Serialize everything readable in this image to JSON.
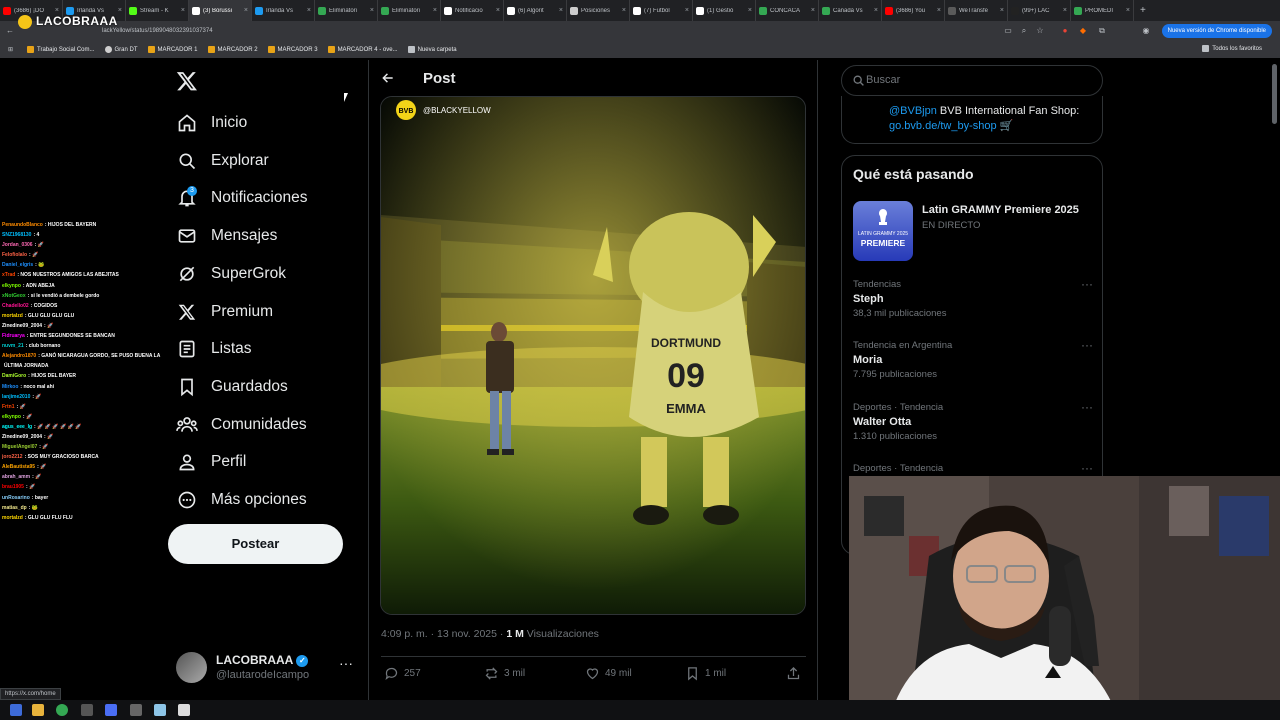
{
  "browser": {
    "tabs": [
      {
        "label": "(3686) ¡DO",
        "color": "#ff0000"
      },
      {
        "label": "Irlanda Vs",
        "color": "#1d9bf0"
      },
      {
        "label": "Stream - K",
        "color": "#53fc18"
      },
      {
        "label": "(3) Borussi",
        "color": "#ffffff",
        "active": true
      },
      {
        "label": "Irlanda Vs",
        "color": "#1d9bf0"
      },
      {
        "label": "Eliminatori",
        "color": "#34a853"
      },
      {
        "label": "Eliminatori",
        "color": "#34a853"
      },
      {
        "label": "Notificacio",
        "color": "#ffffff"
      },
      {
        "label": "(6) Algorit",
        "color": "#ffffff"
      },
      {
        "label": "Posiciones",
        "color": "#cccccc"
      },
      {
        "label": "(7) Futbol",
        "color": "#ffffff"
      },
      {
        "label": "(1) Gestió",
        "color": "#ffffff"
      },
      {
        "label": "CONCACA",
        "color": "#34a853"
      },
      {
        "label": "Canadá Vs",
        "color": "#34a853"
      },
      {
        "label": "(3686) You",
        "color": "#ff0000"
      },
      {
        "label": "WeTransfe",
        "color": "#5a5a5a"
      },
      {
        "label": "(99+) LAC",
        "color": "#222222"
      },
      {
        "label": "PROMEDI",
        "color": "#34a853"
      }
    ],
    "url": "lackYellow/status/1989048032391037374",
    "update_button": "Nueva versión de Chrome disponible",
    "bookmarks": [
      "Trabajo Social Com...",
      "Gran DT",
      "MARCADOR 1",
      "MARCADOR 2",
      "MARCADOR 3",
      "MARCADOR 4 - ove...",
      "Nueva carpeta"
    ],
    "all_bookmarks": "Todos los favoritos",
    "status_url": "https://x.com/home"
  },
  "stream": {
    "logo_text": "LACOBRAAA",
    "chat": [
      {
        "user": "PenaundoBlanco",
        "color": "#ff8c00",
        "msg": "HIJOS DEL BAYERN"
      },
      {
        "user": "SNZ1968130",
        "color": "#00bfff",
        "msg": "4"
      },
      {
        "user": "Jordan_0306",
        "color": "#ff69b4",
        "msg": "🚀"
      },
      {
        "user": "Felofiolalo",
        "color": "#ff6347",
        "msg": "🚀"
      },
      {
        "user": "Daniel_elgris",
        "color": "#1e90ff",
        "msg": "🐸"
      },
      {
        "user": "xTrad",
        "color": "#ff4500",
        "msg": "NOS NUESTROS AMIGOS LAS ABEJITAS"
      },
      {
        "user": "elkynpo",
        "color": "#7fff00",
        "msg": "ADN ABEJA"
      },
      {
        "user": "xNotGeox",
        "color": "#32cd32",
        "msg": "si le vendió a dembele gordo"
      },
      {
        "user": "Chadello02",
        "color": "#ff1493",
        "msg": "COGIDOS"
      },
      {
        "user": "mortalzd",
        "color": "#ffd700",
        "msg": "GLU GLU GLU GLU"
      },
      {
        "user": "Zinedine09_2004",
        "color": "#ffffff",
        "msg": "🚀"
      },
      {
        "user": "Fidruarya",
        "color": "#ff00ff",
        "msg": "ENTRE SEGUNDONES SE BANCAN"
      },
      {
        "user": "nuvm_21",
        "color": "#00ced1",
        "msg": "club bornano"
      },
      {
        "user": "Alejandro1870",
        "color": "#ff8c00",
        "msg": "GANÓ NICARAGUA GORDO, SE PUSO BUENA LA"
      },
      {
        "user": "",
        "color": "#ffffff",
        "msg": "ÚLTIMA JORNADA"
      },
      {
        "user": "DamiGoro",
        "color": "#adff2f",
        "msg": "HIJOS DEL BAYER"
      },
      {
        "user": "Mirkoo",
        "color": "#1e90ff",
        "msg": "noco mal ahi"
      },
      {
        "user": "lanjime2010",
        "color": "#00bfff",
        "msg": "🚀"
      },
      {
        "user": "Frtn1",
        "color": "#ff4500",
        "msg": "🚀"
      },
      {
        "user": "elkynpo",
        "color": "#7fff00",
        "msg": "🚀"
      },
      {
        "user": "agus_eee_lg",
        "color": "#00ffff",
        "msg": "🚀 🚀 🚀 🚀 🚀 🚀"
      },
      {
        "user": "Zinedine09_2004",
        "color": "#ffffff",
        "msg": "🚀"
      },
      {
        "user": "MiguelAngel07",
        "color": "#9acd32",
        "msg": "🚀"
      },
      {
        "user": "joro2212",
        "color": "#ff6347",
        "msg": "SOS MUY GRACIOSO BARCA"
      },
      {
        "user": "AleBautista95",
        "color": "#ffa500",
        "msg": "🚀"
      },
      {
        "user": "abrah_amm",
        "color": "#dda0dd",
        "msg": "🚀"
      },
      {
        "user": "brau1905",
        "color": "#ff0000",
        "msg": "🚀"
      },
      {
        "user": "unRosarino",
        "color": "#87cefa",
        "msg": "bayer"
      },
      {
        "user": "matias_dp",
        "color": "#f0e68c",
        "msg": "🐸"
      },
      {
        "user": "mortalzd",
        "color": "#ffd700",
        "msg": "GLU GLU FLU FLU"
      }
    ]
  },
  "sidebar": {
    "items": [
      {
        "label": "Inicio",
        "icon": "home-icon"
      },
      {
        "label": "Explorar",
        "icon": "search-icon"
      },
      {
        "label": "Notificaciones",
        "icon": "bell-icon",
        "badge": "3"
      },
      {
        "label": "Mensajes",
        "icon": "mail-icon"
      },
      {
        "label": "SuperGrok",
        "icon": "grok-icon"
      },
      {
        "label": "Premium",
        "icon": "x-icon"
      },
      {
        "label": "Listas",
        "icon": "list-icon"
      },
      {
        "label": "Guardados",
        "icon": "bookmark-icon"
      },
      {
        "label": "Comunidades",
        "icon": "people-icon"
      },
      {
        "label": "Perfil",
        "icon": "person-icon"
      },
      {
        "label": "Más opciones",
        "icon": "more-circle-icon"
      }
    ],
    "post_button": "Postear",
    "profile": {
      "name": "LACOBRAAA",
      "handle": "@lautarodeIcampo"
    }
  },
  "main": {
    "header_title": "Post",
    "media_handle": "@BLACKYELLOW",
    "mascot_text": {
      "top": "DORTMUND",
      "number": "09",
      "name": "EMMA"
    },
    "meta": {
      "time": "4:09 p. m. · 13 nov. 2025 ·",
      "views": "1 M",
      "views_label": "Visualizaciones"
    },
    "actions": {
      "replies": "257",
      "reposts": "3 mil",
      "likes": "49 mil",
      "bookmarks": "1 mil"
    }
  },
  "right": {
    "search_placeholder": "Buscar",
    "shop": {
      "handle": "@BVBjpn",
      "text": "BVB International Fan Shop:",
      "link": "go.bvb.de/tw_by-shop"
    },
    "trends_title": "Qué está pasando",
    "live": {
      "title": "Latin GRAMMY Premiere 2025",
      "status": "EN DIRECTO",
      "thumb_top": "LATIN GRAMMY 2025",
      "thumb_main": "PREMIERE"
    },
    "trends": [
      {
        "context": "Tendencias",
        "name": "Steph",
        "count": "38,3 mil publicaciones"
      },
      {
        "context": "Tendencia en Argentina",
        "name": "Moria",
        "count": "7.795 publicaciones"
      },
      {
        "context": "Deportes · Tendencia",
        "name": "Walter Otta",
        "count": "1.310 publicaciones"
      },
      {
        "context": "Deportes · Tendencia",
        "name": "",
        "count": ""
      }
    ]
  }
}
